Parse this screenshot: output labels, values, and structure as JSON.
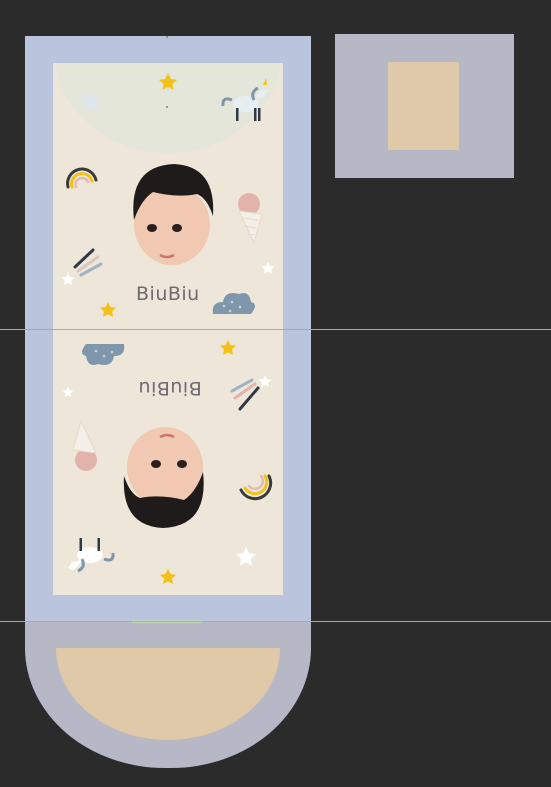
{
  "canvas": {
    "background": "#2b2b2b",
    "guide_color": "#3fd6e0"
  },
  "design": {
    "label_top": "BiuBiu",
    "label_bottom": "BiuBiu",
    "colors": {
      "strip_blue": "#bac4dc",
      "strip_gray": "#b7b8c6",
      "artboard": "#efe6da",
      "tan": "#e0c9a8",
      "sage": "#e3e6d9",
      "star_yellow": "#f2c21b",
      "cloud_blue": "#7f97ab"
    },
    "icons": [
      "star-icon",
      "unicorn-icon",
      "rainbow-icon",
      "ice-cream-icon",
      "shooting-star-icon",
      "cloud-icon",
      "baby-face-photo"
    ]
  },
  "preview_panel": {
    "colors": {
      "outer": "#b7b8c6",
      "inner": "#e0c9a8"
    }
  }
}
